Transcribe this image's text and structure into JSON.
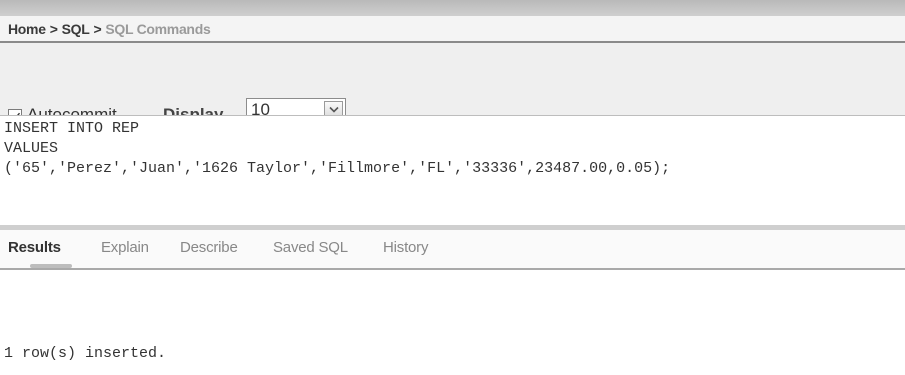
{
  "breadcrumb": {
    "home": "Home",
    "sql": "SQL",
    "current": "SQL Commands",
    "separator": ">"
  },
  "toolbar": {
    "autocommit_label": "Autocommit",
    "autocommit_checked": true,
    "display_label": "Display",
    "display_value": "10"
  },
  "editor": {
    "lines": [
      "INSERT INTO REP",
      "VALUES",
      "('65','Perez','Juan','1626 Taylor','Fillmore','FL','33336',23487.00,0.05);"
    ]
  },
  "tabs": [
    {
      "label": "Results",
      "active": true
    },
    {
      "label": "Explain",
      "active": false
    },
    {
      "label": "Describe",
      "active": false
    },
    {
      "label": "Saved SQL",
      "active": false
    },
    {
      "label": "History",
      "active": false
    }
  ],
  "result_message": "1 row(s) inserted.",
  "colors": {
    "toolbar_bg": "#efefef",
    "breadcrumb_current": "#9a9a9a",
    "tab_inactive": "#888888"
  }
}
